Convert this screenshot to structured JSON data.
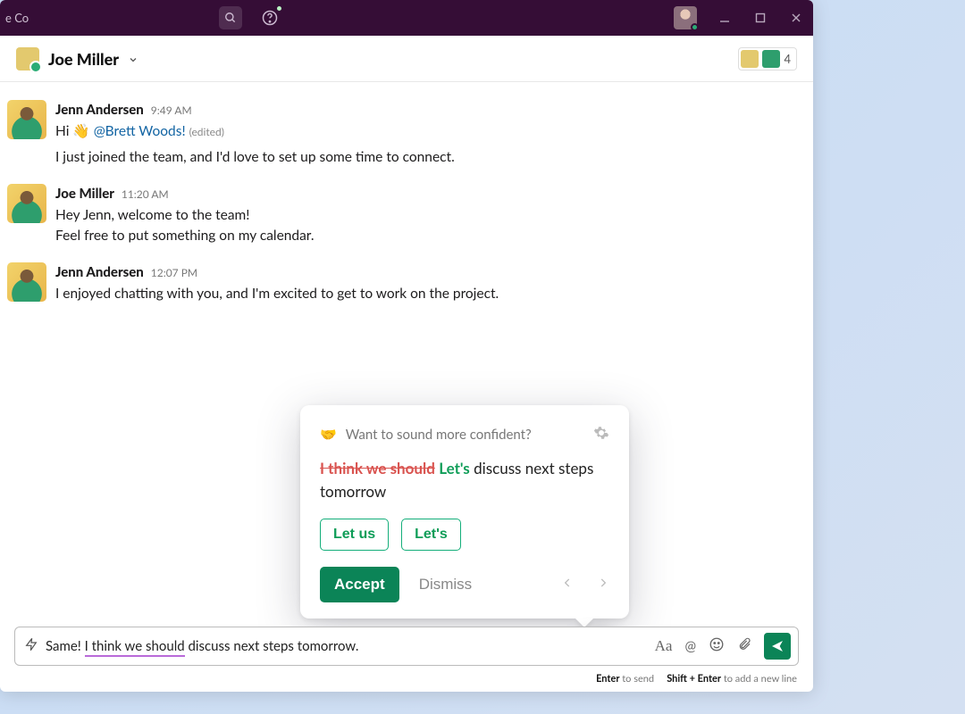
{
  "titlebar": {
    "workspace_fragment": "e Co"
  },
  "channel": {
    "name": "Joe Miller",
    "member_count": "4"
  },
  "messages": [
    {
      "author": "Jenn Andersen",
      "time": "9:49 AM",
      "line1_prefix": "Hi ",
      "mention": "@Brett Woods!",
      "edited": "(edited)",
      "line2": "I just joined the team, and I'd love to set up some time to connect."
    },
    {
      "author": "Joe Miller",
      "time": "11:20 AM",
      "line1": "Hey Jenn, welcome to the team!",
      "line2": "Feel free to put something on my calendar."
    },
    {
      "author": "Jenn Andersen",
      "time": "12:07 PM",
      "line1": "I enjoyed chatting with you, and I'm excited to get to work on the project."
    }
  ],
  "grammarly": {
    "prompt": "Want to sound more confident?",
    "strike": "I think we should",
    "insert": "Let's",
    "rest": " discuss next steps tomorrow",
    "chip1": "Let us",
    "chip2": "Let's",
    "accept": "Accept",
    "dismiss": "Dismiss"
  },
  "composer": {
    "prefix": "Same! ",
    "highlighted": "I think we should",
    "suffix": " discuss next steps tomorrow."
  },
  "hints": {
    "enter_bold": "Enter",
    "enter_rest": " to send",
    "shift_bold": "Shift + Enter",
    "shift_rest": " to add a new line"
  }
}
